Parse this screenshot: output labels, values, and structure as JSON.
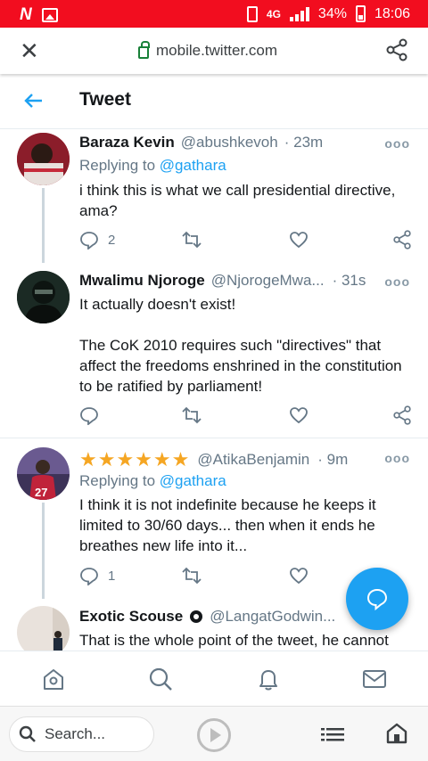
{
  "status_bar": {
    "network": "4G",
    "battery": "34%",
    "time": "18:06",
    "background": "#f20d1f"
  },
  "url_bar": {
    "url": "mobile.twitter.com",
    "close_icon": "close-icon",
    "share_icon": "share-icon"
  },
  "header": {
    "title": "Tweet",
    "back_icon": "back-arrow-icon"
  },
  "tweets": [
    {
      "name": "Baraza Kevin",
      "handle": "@abushkevoh",
      "time": "· 23m",
      "replying_prefix": "Replying to ",
      "replying_to": "@gathara",
      "body": "i think this is what we call presidential directive, ama?",
      "reply_count": "2",
      "retweet_count": "",
      "like_count": ""
    },
    {
      "name": "Mwalimu Njoroge",
      "handle": "@NjorogeMwa...",
      "time": "· 31s",
      "body_line1": "It actually doesn't exist!",
      "body_line2": "The CoK 2010 requires such \"directives\" that affect the freedoms enshrined in the constitution to be ratified by parliament!",
      "reply_count": "",
      "retweet_count": "",
      "like_count": ""
    },
    {
      "name_stars": "★★★★★★",
      "handle": "@AtikaBenjamin",
      "time": "· 9m",
      "replying_prefix": "Replying to ",
      "replying_to": "@gathara",
      "body": "I think it is not indefinite because he keeps it limited to 30/60 days... then when it ends he breathes new life into it...",
      "reply_count": "1",
      "retweet_count": "",
      "like_count": ""
    },
    {
      "name": "Exotic Scouse",
      "handle": "@LangatGodwin...",
      "body": "That is the whole point of the tweet, he cannot"
    }
  ],
  "fab": {
    "icon": "compose-reply-icon",
    "color": "#1da1f2"
  },
  "bottom_nav": {
    "items": [
      "home-icon",
      "search-icon",
      "notifications-icon",
      "messages-icon"
    ]
  },
  "browser_bar": {
    "search_placeholder": "Search...",
    "play_icon": "play-icon",
    "list_icon": "list-icon",
    "home_icon": "browser-home-icon"
  },
  "colors": {
    "accent": "#1da1f2",
    "secondary_text": "#657786",
    "star": "#f5a623"
  }
}
